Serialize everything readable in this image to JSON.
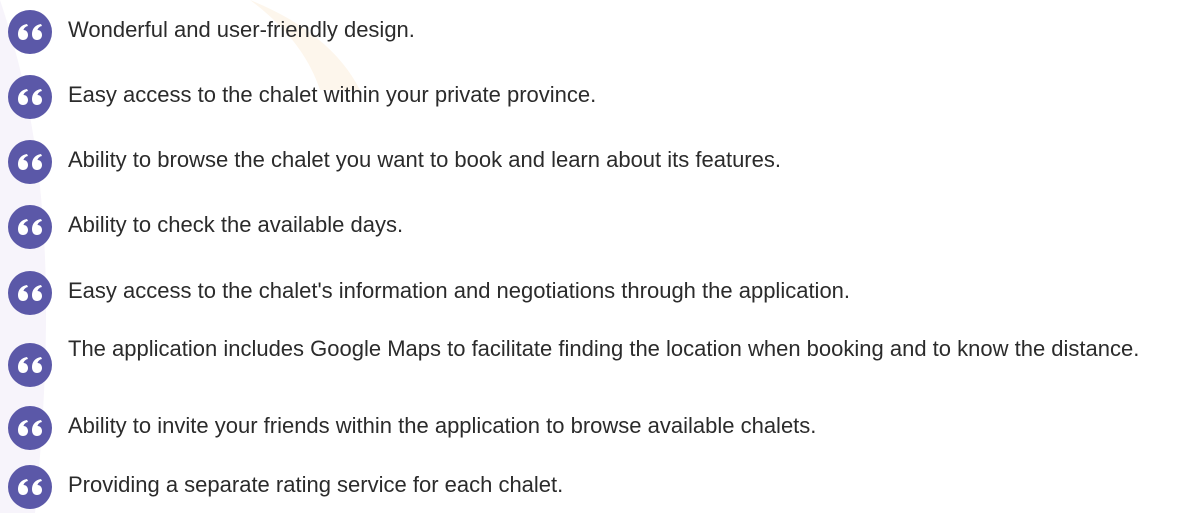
{
  "colors": {
    "icon_bg": "#5b58a8",
    "icon_fg": "#ffffff",
    "text": "#2b2b2b",
    "accent_shape": "#f6f3fb"
  },
  "icon": "quote-icon",
  "features": [
    {
      "text": " Wonderful and user-friendly design."
    },
    {
      "text": "Easy access to the chalet within your private province."
    },
    {
      "text": "Ability to browse the chalet you want to book and learn about its features."
    },
    {
      "text": "Ability to check the available days."
    },
    {
      "text": "Easy access to the chalet's information and negotiations through the application."
    },
    {
      "text": "The application includes Google Maps to facilitate finding the location when booking and to know the distance."
    },
    {
      "text": " Ability to invite your friends within the application to browse available chalets."
    },
    {
      "text": "Providing a separate rating service for each chalet."
    }
  ]
}
